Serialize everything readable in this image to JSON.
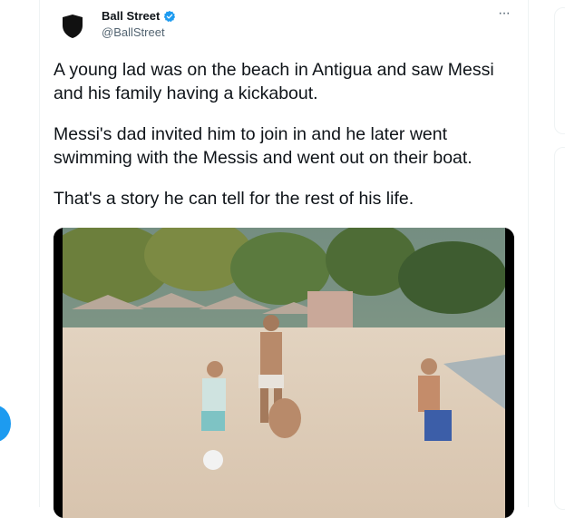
{
  "author": {
    "name": "Ball Street",
    "handle": "@BallStreet",
    "verified": true
  },
  "tweet": {
    "paragraphs": [
      "A young lad was on the beach in Antigua and saw Messi and his family having a kickabout.",
      "Messi's dad invited him to join in and he later went swimming with the Messis and went out on their boat.",
      "That's a story he can tell for the rest of his life."
    ]
  },
  "more_label": "···",
  "colors": {
    "text": "#0f1419",
    "secondary": "#536471",
    "accent": "#1d9bf0"
  }
}
